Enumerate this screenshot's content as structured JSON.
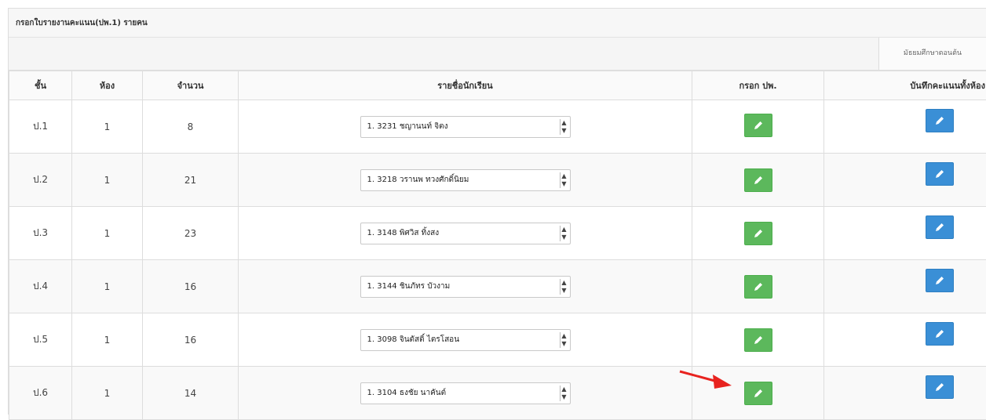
{
  "panel": {
    "title": "กรอกใบรายงานคะแนน(ปพ.1) รายคน",
    "top_link": "มัธยมศึกษาตอนต้น"
  },
  "table": {
    "headers": [
      "ชั้น",
      "ห้อง",
      "จำนวน",
      "รายชื่อนักเรียน",
      "กรอก ปพ.",
      "บันทึกคะแนนทั้งห้อง"
    ],
    "rows": [
      {
        "grade": "ป.1",
        "room": "1",
        "count": "8",
        "student": "1. 3231 ชญานนท์ จิตง"
      },
      {
        "grade": "ป.2",
        "room": "1",
        "count": "21",
        "student": "1. 3218 วรานพ ทวงศักดิ์นิยม"
      },
      {
        "grade": "ป.3",
        "room": "1",
        "count": "23",
        "student": "1. 3148 พิศวิส ทิ้งสง"
      },
      {
        "grade": "ป.4",
        "room": "1",
        "count": "16",
        "student": "1. 3144 ชินภัทร บัวงาม"
      },
      {
        "grade": "ป.5",
        "room": "1",
        "count": "16",
        "student": "1. 3098 จินตัสติ์ ไตรโสอน"
      },
      {
        "grade": "ป.6",
        "room": "1",
        "count": "14",
        "student": "1. 3104 ธงชัย นาคันต์"
      }
    ]
  },
  "icons": {
    "edit_record": "pencil-icon",
    "save_scores": "pencil-icon",
    "pointer": "red-arrow-icon"
  },
  "colors": {
    "green_button": "#5cb85c",
    "blue_button": "#3a8fd6",
    "arrow": "#e8231f"
  }
}
